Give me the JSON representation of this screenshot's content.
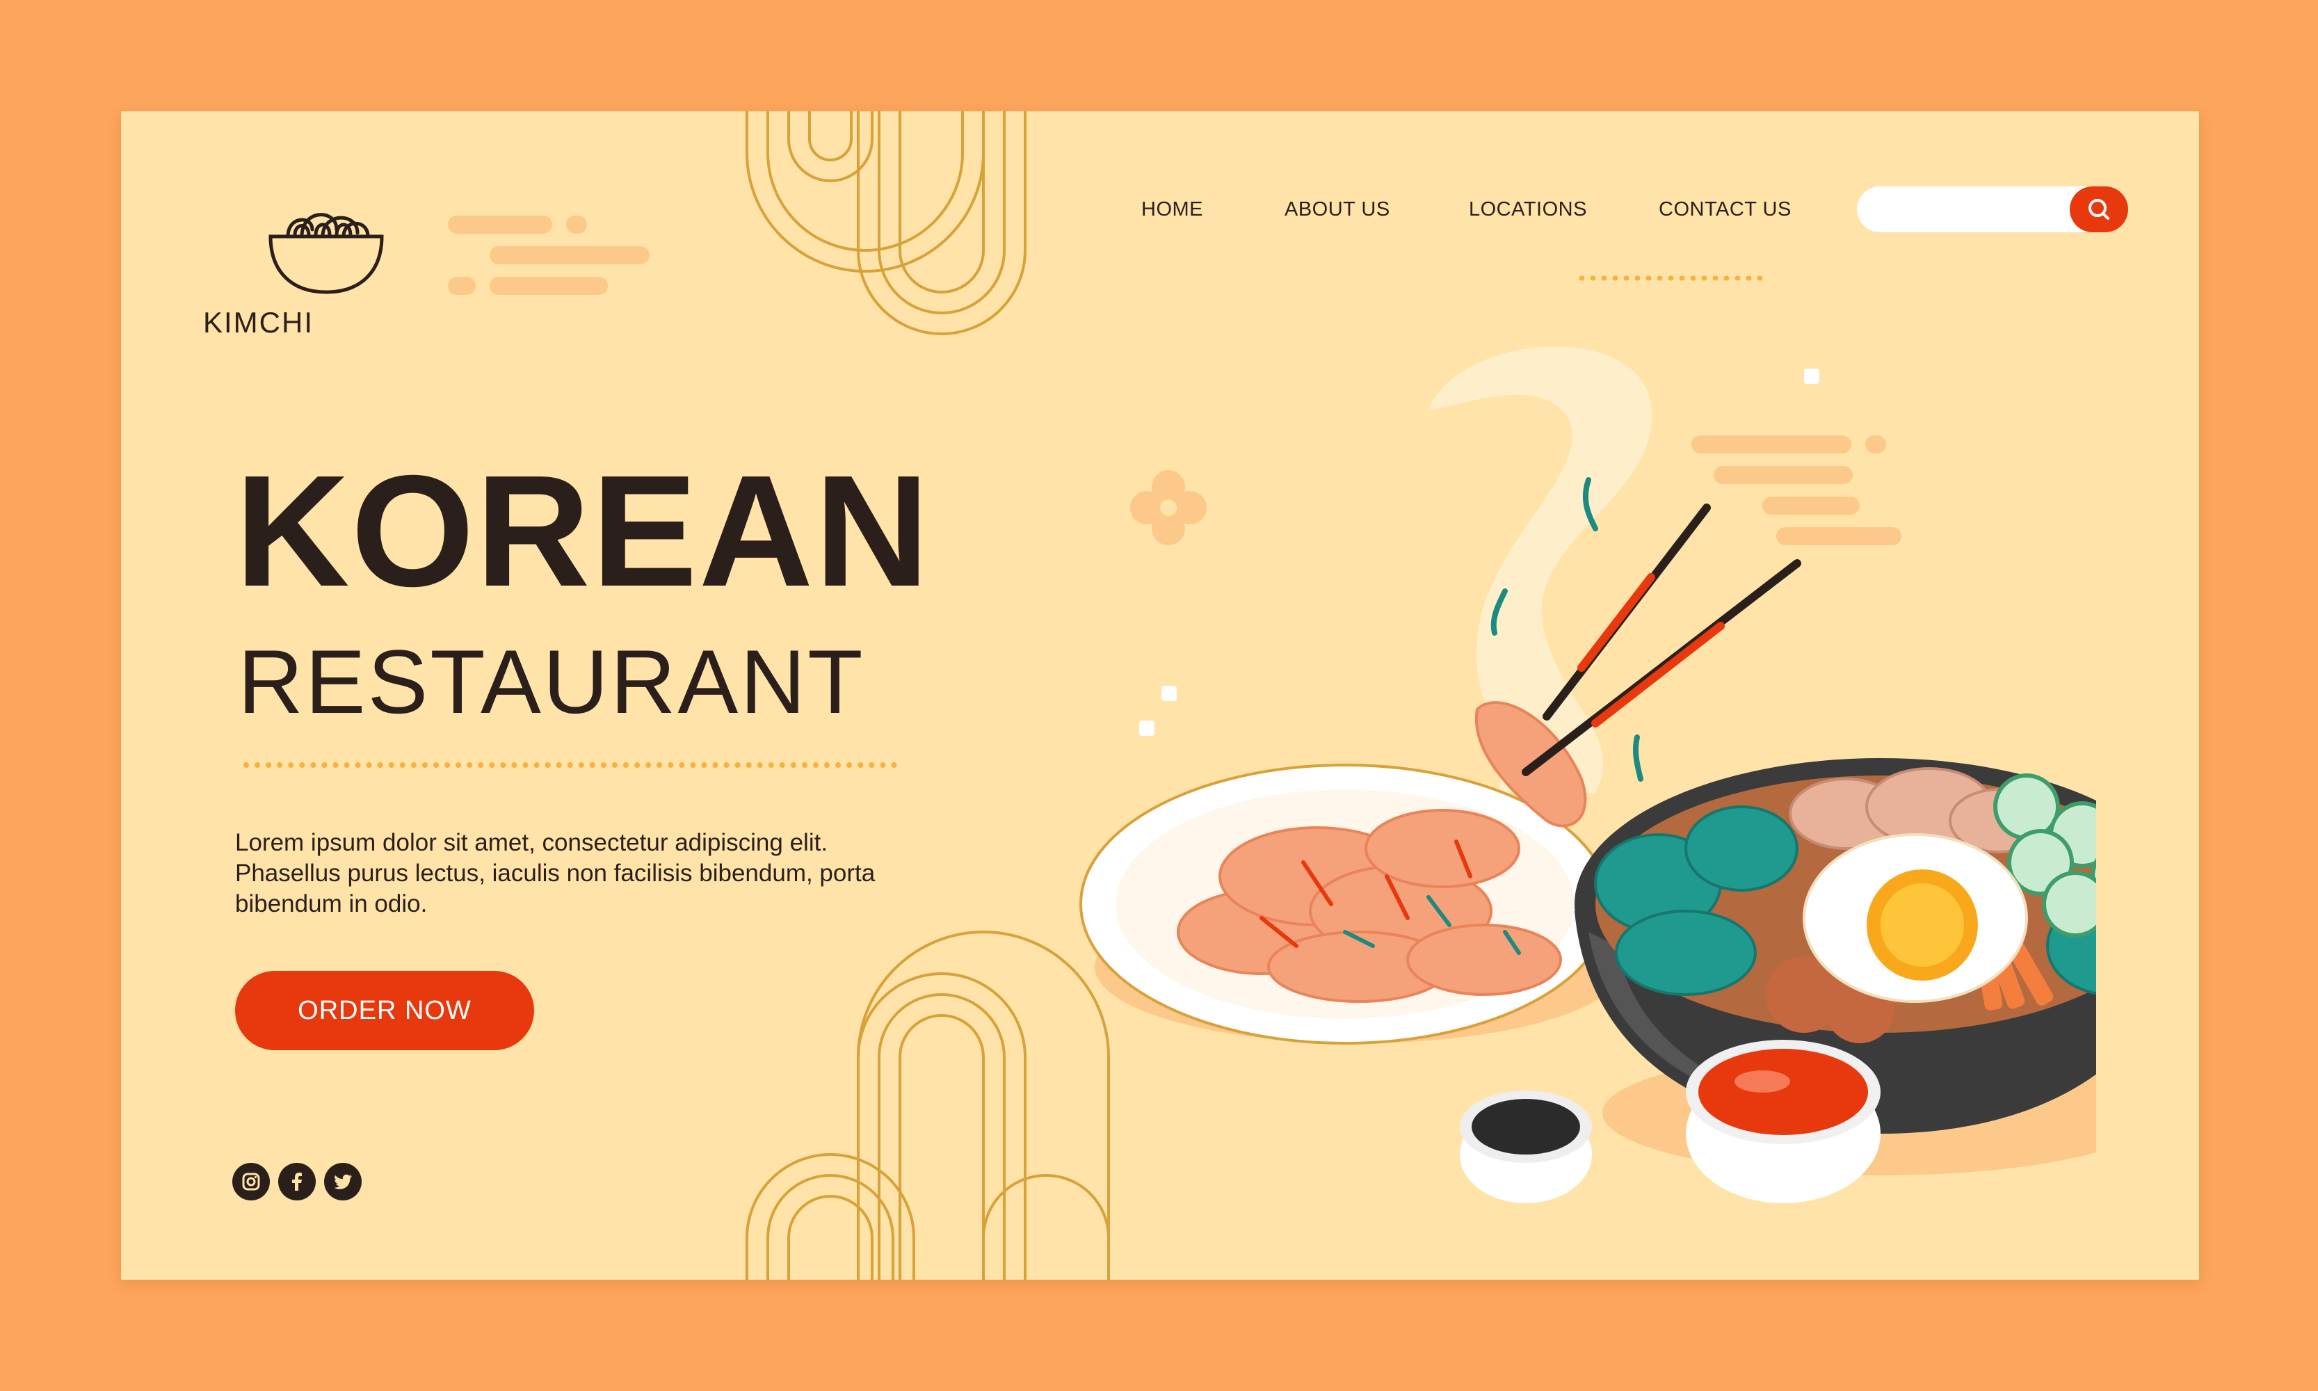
{
  "brand": {
    "name": "KIMCHI"
  },
  "nav": {
    "items": [
      {
        "label": "HOME"
      },
      {
        "label": "ABOUT US"
      },
      {
        "label": "LOCATIONS"
      },
      {
        "label": "CONTACT US"
      }
    ]
  },
  "search": {
    "value": "",
    "placeholder": "",
    "icon": "search-icon"
  },
  "hero": {
    "title": "KOREAN",
    "subtitle": "RESTAURANT",
    "description": "Lorem ipsum dolor sit amet, consectetur adipiscing elit. Phasellus purus lectus, iaculis non facilisis bibendum, porta bibendum in odio.",
    "cta_label": "ORDER NOW"
  },
  "social": [
    {
      "icon": "instagram-icon"
    },
    {
      "icon": "facebook-icon"
    },
    {
      "icon": "twitter-icon"
    }
  ],
  "colors": {
    "page_bg": "#fca55c",
    "card_bg": "#ffe3a8",
    "accent": "#e8380d",
    "text": "#2b1f1c",
    "line": "#d9a13a"
  }
}
